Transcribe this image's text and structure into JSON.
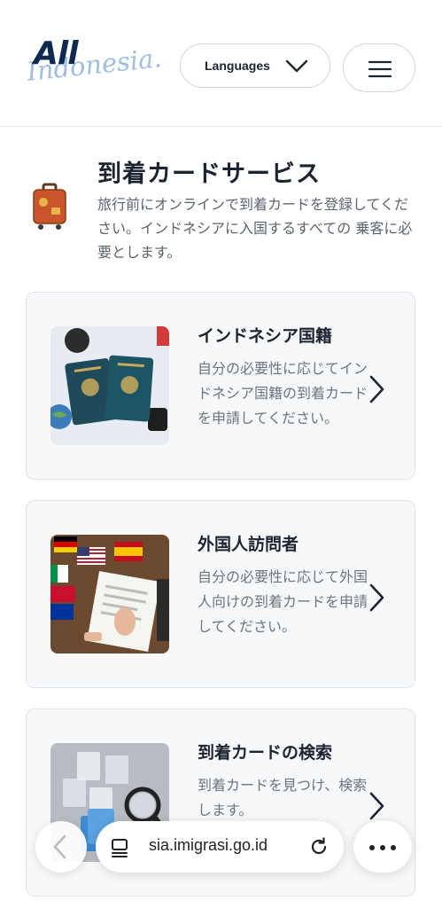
{
  "header": {
    "logo_top": "All",
    "logo_script": "Indonesia.",
    "languages_label": "Languages"
  },
  "intro": {
    "icon": "suitcase-icon",
    "title": "到着カードサービス",
    "description": "旅行前にオンラインで到着カードを登録してください。インドネシアに入国するすべての 乗客に必要とします。"
  },
  "cards": [
    {
      "title": "インドネシア国籍",
      "description": "自分の必要性に応じてインドネシア国籍の到着カードを申請してください。",
      "image": "passports-image"
    },
    {
      "title": "外国人訪問者",
      "description": "自分の必要性に応じて外国人向けの到着カードを申請してください。",
      "image": "flags-form-image"
    },
    {
      "title": "到着カードの検索",
      "description": "到着カードを見つけ、検索します。",
      "image": "search-documents-image"
    }
  ],
  "browser": {
    "url": "sia.imigrasi.go.id"
  },
  "colors": {
    "brand_navy": "#0f2a4f",
    "brand_light_blue": "#8fb3da",
    "suitcase": "#c8562a",
    "card_bg": "#f6f8fa"
  }
}
